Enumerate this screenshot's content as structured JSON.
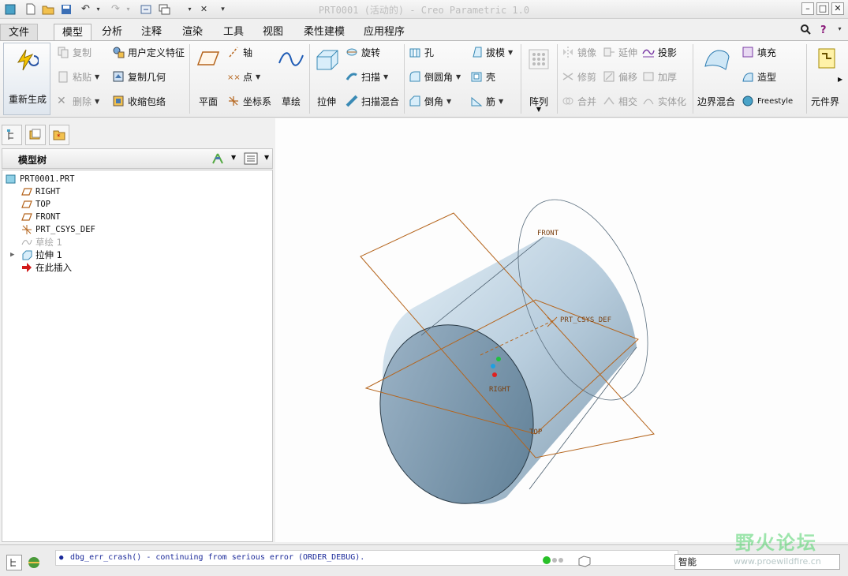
{
  "window": {
    "title": "PRT0001 (活动的) - Creo Parametric 1.0"
  },
  "menu_tabs": [
    {
      "label": "文件"
    },
    {
      "label": "模型"
    },
    {
      "label": "分析"
    },
    {
      "label": "注释"
    },
    {
      "label": "渲染"
    },
    {
      "label": "工具"
    },
    {
      "label": "视图"
    },
    {
      "label": "柔性建模"
    },
    {
      "label": "应用程序"
    }
  ],
  "active_tab": "模型",
  "ribbon": {
    "regenerate": "重新生成",
    "copy": "复制",
    "paste": "粘贴",
    "delete": "删除",
    "user_defined_feature": "用户定义特征",
    "copy_geometry": "复制几何",
    "shrinkwrap": "收缩包络",
    "plane": "平面",
    "axis": "轴",
    "point": "点",
    "csys": "坐标系",
    "sketch": "草绘",
    "extrude": "拉伸",
    "revolve": "旋转",
    "sweep": "扫描",
    "swept_blend": "扫描混合",
    "hole": "孔",
    "round": "倒圆角",
    "chamfer": "倒角",
    "draft": "拔模",
    "shell": "壳",
    "rib": "筋",
    "pattern": "阵列",
    "mirror": "镜像",
    "trim": "修剪",
    "merge": "合并",
    "extend": "延伸",
    "offset": "偏移",
    "intersect": "相交",
    "project": "投影",
    "thicken": "加厚",
    "solidify": "实体化",
    "boundary_blend": "边界混合",
    "fill": "填充",
    "style": "造型",
    "freestyle": "Freestyle",
    "component": "元件界"
  },
  "model_tree": {
    "header": "模型树",
    "items": [
      {
        "label": "PRT0001.PRT",
        "icon": "part-icon"
      },
      {
        "label": "RIGHT",
        "icon": "datum-plane-icon"
      },
      {
        "label": "TOP",
        "icon": "datum-plane-icon"
      },
      {
        "label": "FRONT",
        "icon": "datum-plane-icon"
      },
      {
        "label": "PRT_CSYS_DEF",
        "icon": "csys-icon"
      },
      {
        "label": "草绘 1",
        "icon": "sketch-icon",
        "hidden": true
      },
      {
        "label": "拉伸 1",
        "icon": "extrude-icon"
      },
      {
        "label": "在此插入",
        "icon": "insert-arrow-icon"
      }
    ]
  },
  "graphics": {
    "labels": {
      "front": "FRONT",
      "csys": "PRT_CSYS_DEF",
      "right": "RIGHT",
      "top": "TOP"
    },
    "colors": {
      "datum": "#b5651d",
      "body_light": "#dfeaf3",
      "body_dark": "#5d7d94"
    }
  },
  "status": {
    "message": "dbg_err_crash() - continuing from serious error (ORDER_DEBUG).",
    "filter": "智能"
  },
  "watermark": {
    "text": "野火论坛",
    "url": "www.proewildfire.cn"
  }
}
